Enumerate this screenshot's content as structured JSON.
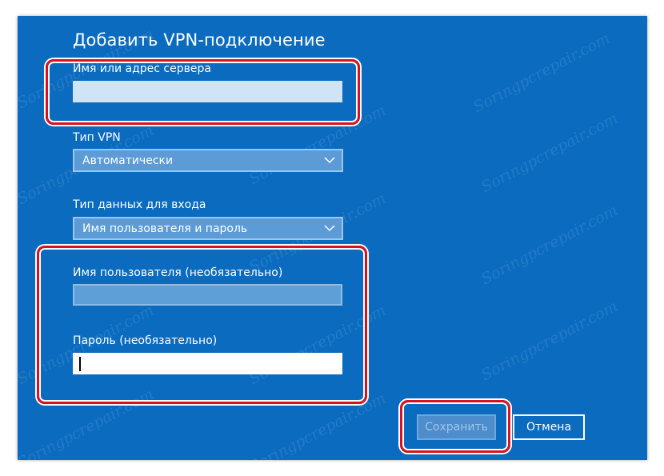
{
  "dialog": {
    "title": "Добавить VPN-подключение"
  },
  "server": {
    "label": "Имя или адрес сервера",
    "value": "",
    "placeholder": ""
  },
  "vpn_type": {
    "label": "Тип VPN",
    "selected": "Автоматически"
  },
  "signin_type": {
    "label": "Тип данных для входа",
    "selected": "Имя пользователя и пароль"
  },
  "username": {
    "label": "Имя пользователя (необязательно)",
    "value": ""
  },
  "password": {
    "label": "Пароль (необязательно)",
    "value": ""
  },
  "buttons": {
    "save": "Сохранить",
    "cancel": "Отмена"
  },
  "watermark": "Soringpcrepair.com",
  "colors": {
    "dialog_bg": "#0a6bbf",
    "highlight": "#d9121f"
  }
}
